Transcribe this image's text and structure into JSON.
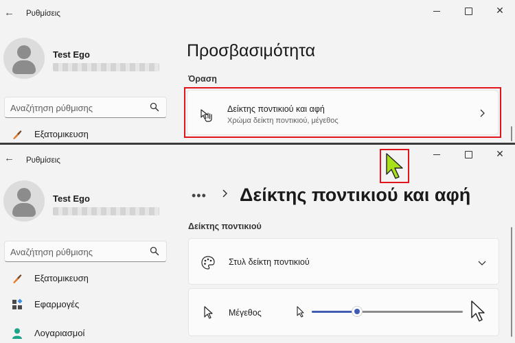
{
  "app_title": "Ρυθμίσεις",
  "user": {
    "name": "Test Ego"
  },
  "search": {
    "placeholder": "Αναζήτηση ρύθμισης"
  },
  "panel1": {
    "page_title": "Προσβασιμότητα",
    "section": "Όραση",
    "card": {
      "title": "Δείκτης ποντικιού και αφή",
      "subtitle": "Χρώμα δείκτη ποντικιού, μέγεθος"
    },
    "nav_partial": "Εξατομικευση"
  },
  "panel2": {
    "breadcrumb_dots": "•••",
    "page_title": "Δείκτης ποντικιού και αφή",
    "section": "Δείκτης ποντικιού",
    "style_card": {
      "title": "Στυλ δείκτη ποντικιού"
    },
    "size_card": {
      "title": "Μέγεθος",
      "slider_fraction": 0.3
    },
    "nav": [
      {
        "label": "Εξατομικευση",
        "icon": "brush-icon"
      },
      {
        "label": "Εφαρμογές",
        "icon": "apps-icon"
      },
      {
        "label": "Λογαριασμοί",
        "icon": "account-icon"
      }
    ]
  },
  "colors": {
    "accent": "#3f5bb4",
    "highlight": "#e2131a",
    "pointer_lime": "#a8e01a"
  }
}
